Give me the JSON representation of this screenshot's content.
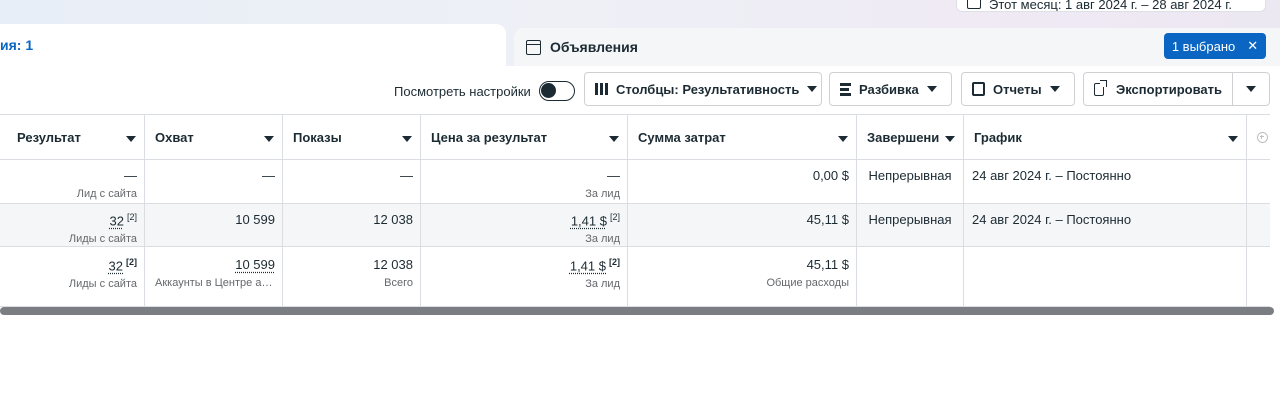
{
  "header": {
    "date_range": "Этот месяц: 1 авг 2024 г. – 28 авг 2024 г."
  },
  "tabs": {
    "left_label": "ия: 1",
    "ads_label": "Объявления",
    "selected_label": "1 выбрано",
    "selected_close": "✕"
  },
  "toolbar": {
    "view_settings": "Посмотреть настройки",
    "columns": "Столбцы: Результативность",
    "breakdown": "Разбивка",
    "reports": "Отчеты",
    "export": "Экспортировать"
  },
  "table": {
    "columns": [
      "Результат",
      "Охват",
      "Показы",
      "Цена за результат",
      "Сумма затрат",
      "Завершени",
      "График"
    ],
    "rows": [
      {
        "result": "—",
        "result_sub": "Лид с сайта",
        "reach": "—",
        "impressions": "—",
        "cpr": "—",
        "cpr_sub": "За лид",
        "spend": "0,00 $",
        "end": "Непрерывная",
        "schedule": "24 авг 2024 г. – Постоянно"
      },
      {
        "result": "32",
        "result_note": "[2]",
        "result_sub": "Лиды с сайта",
        "reach": "10 599",
        "impressions": "12 038",
        "cpr": "1,41 $",
        "cpr_note": "[2]",
        "cpr_sub": "За лид",
        "spend": "45,11 $",
        "end": "Непрерывная",
        "schedule": "24 авг 2024 г. – Постоянно"
      }
    ],
    "total": {
      "result": "32",
      "result_note": "[2]",
      "result_sub": "Лиды с сайта",
      "reach": "10 599",
      "reach_sub": "Аккаунты в Центре ак…",
      "impressions": "12 038",
      "impressions_sub": "Всего",
      "cpr": "1,41 $",
      "cpr_note": "[2]",
      "cpr_sub": "За лид",
      "spend": "45,11 $",
      "spend_sub": "Общие расходы"
    }
  },
  "icons": {
    "calendar": "calendar-icon",
    "ad": "ad-icon",
    "columns": "columns-icon",
    "breakdown": "breakdown-icon",
    "reports": "reports-icon",
    "export": "export-icon",
    "add_column": "add-column-icon"
  },
  "colors": {
    "accent": "#0a66c2",
    "text": "#1c2b33",
    "row_alt": "#f5f6f7"
  }
}
